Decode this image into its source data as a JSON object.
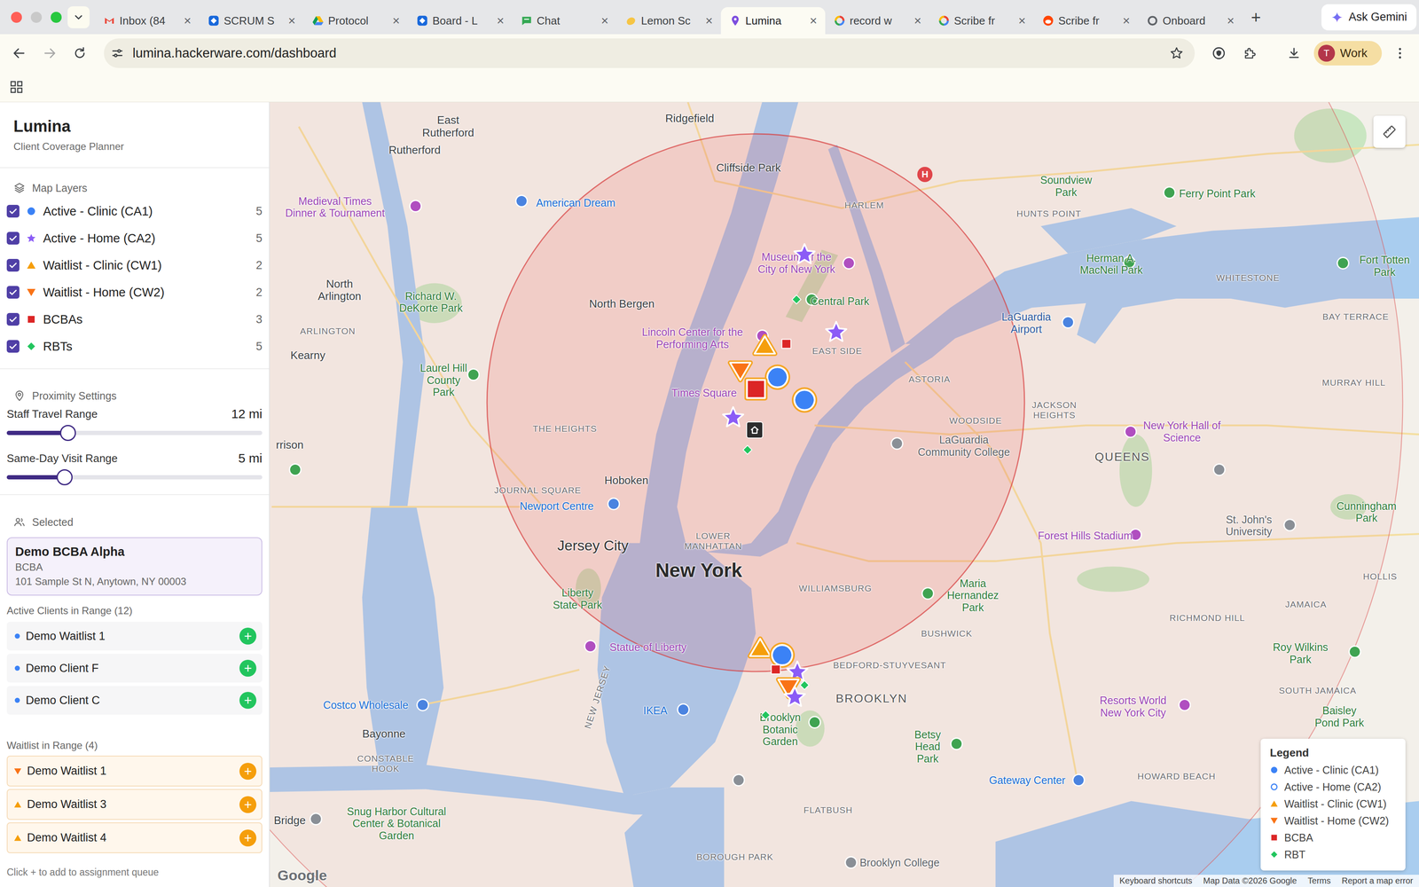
{
  "browser": {
    "tabs": [
      {
        "label": "Inbox (84",
        "kind": "gmail",
        "selected": false
      },
      {
        "label": "SCRUM S",
        "kind": "jira",
        "selected": false
      },
      {
        "label": "Protocol",
        "kind": "drive",
        "selected": false
      },
      {
        "label": "Board - L",
        "kind": "jira",
        "selected": false
      },
      {
        "label": "Chat",
        "kind": "chat",
        "selected": false
      },
      {
        "label": "Lemon Sc",
        "kind": "lemon",
        "selected": false
      },
      {
        "label": "Lumina",
        "kind": "pin",
        "selected": true
      },
      {
        "label": "record w",
        "kind": "google",
        "selected": false
      },
      {
        "label": "Scribe fr",
        "kind": "google",
        "selected": false
      },
      {
        "label": "Scribe fr",
        "kind": "reddit",
        "selected": false
      },
      {
        "label": "Onboard",
        "kind": "docs",
        "selected": false
      }
    ],
    "close": "×",
    "new_tab": "+",
    "gemini": "Ask Gemini",
    "url": "lumina.hackerware.com/dashboard",
    "profile": {
      "initial": "T",
      "label": "Work"
    }
  },
  "sidebar": {
    "title": "Lumina",
    "subtitle": "Client Coverage Planner",
    "layers_title": "Map Layers",
    "layers": [
      {
        "label": "Active - Clinic (CA1)",
        "count": "5",
        "checked": true,
        "kind": "circle",
        "color": "#3b82f6"
      },
      {
        "label": "Active - Home (CA2)",
        "count": "5",
        "checked": true,
        "kind": "star",
        "color": "#8b5cf6"
      },
      {
        "label": "Waitlist - Clinic (CW1)",
        "count": "2",
        "checked": true,
        "kind": "triangle",
        "color": "#f59e0b"
      },
      {
        "label": "Waitlist - Home (CW2)",
        "count": "2",
        "checked": true,
        "kind": "triangle-down",
        "color": "#f97316"
      },
      {
        "label": "BCBAs",
        "count": "3",
        "checked": true,
        "kind": "square",
        "color": "#dc2626"
      },
      {
        "label": "RBTs",
        "count": "5",
        "checked": true,
        "kind": "diamond",
        "color": "#22c55e"
      }
    ],
    "proximity_title": "Proximity Settings",
    "sliders": [
      {
        "label": "Staff Travel Range",
        "reading": "12 mi",
        "level": 0.24
      },
      {
        "label": "Same-Day Visit Range",
        "reading": "5 mi",
        "level": 0.227
      }
    ],
    "selected_title": "Selected",
    "selected": {
      "name": "Demo BCBA Alpha",
      "role": "BCBA",
      "address": "101 Sample St N, Anytown, NY 00003"
    },
    "add_label": "+",
    "active_title": "Active Clients in Range (12)",
    "active_clients": [
      {
        "name": "Demo Waitlist 1",
        "kind": "circle"
      },
      {
        "name": "Demo Client F",
        "kind": "circle"
      },
      {
        "name": "Demo Client C",
        "kind": "circle"
      }
    ],
    "waitlist_title": "Waitlist in Range (4)",
    "waitlist": [
      {
        "name": "Demo Waitlist 1",
        "kind": "triangle-down"
      },
      {
        "name": "Demo Waitlist 3",
        "kind": "triangle"
      },
      {
        "name": "Demo Waitlist 4",
        "kind": "triangle"
      }
    ],
    "hint": "Click + to add to assignment queue"
  },
  "map": {
    "labels": [
      {
        "text": "East Rutherford",
        "kind": "place",
        "color": "#3c4043"
      },
      {
        "text": "Ridgefield",
        "kind": "place",
        "color": "#3c4043"
      },
      {
        "text": "Rutherford",
        "kind": "place",
        "color": "#3c4043"
      },
      {
        "text": "Cliffside Park",
        "kind": "place",
        "color": "#3c4043"
      },
      {
        "text": "Medieval Times Dinner & Tournament",
        "kind": "poi",
        "color": "#9b45b5"
      },
      {
        "text": "American Dream",
        "kind": "poi",
        "color": "#1a6fd6"
      },
      {
        "text": "HARLEM",
        "kind": "district",
        "color": "#6f6f73"
      },
      {
        "text": "North Arlington",
        "kind": "place",
        "color": "#3c4043"
      },
      {
        "text": "North Bergen",
        "kind": "place",
        "color": "#3c4043"
      },
      {
        "text": "Richard W. DeKorte Park",
        "kind": "poi",
        "color": "#2f7d3b"
      },
      {
        "text": "ARLINGTON",
        "kind": "district",
        "color": "#6f6f73"
      },
      {
        "text": "Kearny",
        "kind": "place",
        "color": "#3c4043"
      },
      {
        "text": "Museum of the City of New York",
        "kind": "poi",
        "color": "#9b45b5"
      },
      {
        "text": "Central Park",
        "kind": "poi",
        "color": "#2f7d3b"
      },
      {
        "text": "Lincoln Center for the Performing Arts",
        "kind": "poi",
        "color": "#9b45b5"
      },
      {
        "text": "EAST SIDE",
        "kind": "district",
        "color": "#6f6f73"
      },
      {
        "text": "Times Square",
        "kind": "poi",
        "color": "#9b45b5"
      },
      {
        "text": "ASTORIA",
        "kind": "district",
        "color": "#6f6f73"
      },
      {
        "text": "Laurel Hill County Park",
        "kind": "poi",
        "color": "#2f7d3b"
      },
      {
        "text": "LaGuardia Airport",
        "kind": "poi",
        "color": "#2d5aa0"
      },
      {
        "text": "Soundview Park",
        "kind": "poi",
        "color": "#2f7d3b"
      },
      {
        "text": "HUNTS POINT",
        "kind": "district",
        "color": "#6f6f73"
      },
      {
        "text": "Herman A. MacNeil Park",
        "kind": "poi",
        "color": "#2f7d3b"
      },
      {
        "text": "WHITESTONE",
        "kind": "district",
        "color": "#6f6f73"
      },
      {
        "text": "Ferry Point Park",
        "kind": "poi",
        "color": "#2f7d3b"
      },
      {
        "text": "Fort Totten Park",
        "kind": "poi",
        "color": "#2f7d3b"
      },
      {
        "text": "BAY TERRACE",
        "kind": "district",
        "color": "#6f6f73"
      },
      {
        "text": "MURRAY HILL",
        "kind": "district",
        "color": "#6f6f73"
      },
      {
        "text": "JACKSON HEIGHTS",
        "kind": "district",
        "color": "#6f6f73"
      },
      {
        "text": "WOODSIDE",
        "kind": "district",
        "color": "#6f6f73"
      },
      {
        "text": "LaGuardia Community College",
        "kind": "poi",
        "color": "#5f6368"
      },
      {
        "text": "New York Hall of Science",
        "kind": "poi",
        "color": "#9b45b5"
      },
      {
        "text": "QUEENS",
        "kind": "borough",
        "color": "#555555"
      },
      {
        "text": "THE HEIGHTS",
        "kind": "district",
        "color": "#6f6f73"
      },
      {
        "text": "Hoboken",
        "kind": "place",
        "color": "#3c4043"
      },
      {
        "text": "JOURNAL SQUARE",
        "kind": "district",
        "color": "#6f6f73"
      },
      {
        "text": "Newport Centre",
        "kind": "poi",
        "color": "#1a6fd6"
      },
      {
        "text": "LOWER MANHATTAN",
        "kind": "district",
        "color": "#6f6f73"
      },
      {
        "text": "Jersey City",
        "kind": "town",
        "color": "#333333"
      },
      {
        "text": "New York",
        "kind": "city",
        "color": "#2b2b2b"
      },
      {
        "text": "WILLIAMSBURG",
        "kind": "district",
        "color": "#6f6f73"
      },
      {
        "text": "Forest Hills Stadium",
        "kind": "poi",
        "color": "#9b45b5"
      },
      {
        "text": "St. John's University",
        "kind": "poi",
        "color": "#5f6368"
      },
      {
        "text": "Cunningham Park",
        "kind": "poi",
        "color": "#2f7d3b"
      },
      {
        "text": "Liberty State Park",
        "kind": "poi",
        "color": "#2f7d3b"
      },
      {
        "text": "Maria Hernandez Park",
        "kind": "poi",
        "color": "#2f7d3b"
      },
      {
        "text": "BUSHWICK",
        "kind": "district",
        "color": "#6f6f73"
      },
      {
        "text": "Statue of Liberty",
        "kind": "poi",
        "color": "#9b45b5"
      },
      {
        "text": "BEDFORD-STUYVESANT",
        "kind": "district",
        "color": "#6f6f73"
      },
      {
        "text": "RICHMOND HILL",
        "kind": "district",
        "color": "#6f6f73"
      },
      {
        "text": "HOLLIS",
        "kind": "district",
        "color": "#6f6f73"
      },
      {
        "text": "JAMAICA",
        "kind": "district",
        "color": "#6f6f73"
      },
      {
        "text": "Roy Wilkins Park",
        "kind": "poi",
        "color": "#2f7d3b"
      },
      {
        "text": "SOUTH JAMAICA",
        "kind": "district",
        "color": "#6f6f73"
      },
      {
        "text": "BROOKLYN",
        "kind": "borough",
        "color": "#555555"
      },
      {
        "text": "Costco Wholesale",
        "kind": "poi",
        "color": "#1a6fd6"
      },
      {
        "text": "IKEA",
        "kind": "poi",
        "color": "#1a6fd6"
      },
      {
        "text": "Brooklyn Botanic Garden",
        "kind": "poi",
        "color": "#2f7d3b"
      },
      {
        "text": "Resorts World New York City",
        "kind": "poi",
        "color": "#9b45b5"
      },
      {
        "text": "Baisley Pond Park",
        "kind": "poi",
        "color": "#2f7d3b"
      },
      {
        "text": "Bayonne",
        "kind": "place",
        "color": "#3c4043"
      },
      {
        "text": "Betsy Head Park",
        "kind": "poi",
        "color": "#2f7d3b"
      },
      {
        "text": "CONSTABLE HOOK",
        "kind": "district",
        "color": "#6f6f73"
      },
      {
        "text": "Gateway Center",
        "kind": "poi",
        "color": "#1a6fd6"
      },
      {
        "text": "HOWARD BEACH",
        "kind": "district",
        "color": "#6f6f73"
      },
      {
        "text": "NEW JERSEY",
        "kind": "state",
        "color": "#6f6f73"
      },
      {
        "text": "Snug Harbor Cultural Center & Botanical Garden",
        "kind": "poi",
        "color": "#2f7d3b"
      },
      {
        "text": "Bridge",
        "kind": "place",
        "color": "#3c4043"
      },
      {
        "text": "FLATBUSH",
        "kind": "district",
        "color": "#6f6f73"
      },
      {
        "text": "BOROUGH PARK",
        "kind": "district",
        "color": "#6f6f73"
      },
      {
        "text": "Brooklyn College",
        "kind": "poi",
        "color": "#5f6368"
      },
      {
        "text": "rrison",
        "kind": "place",
        "color": "#3c4043"
      }
    ],
    "markers": [
      {
        "kind": "star",
        "highlighted": false,
        "selected": false
      },
      {
        "kind": "diamond",
        "highlighted": false,
        "selected": false
      },
      {
        "kind": "triangle",
        "highlighted": true,
        "selected": false
      },
      {
        "kind": "square",
        "highlighted": false,
        "selected": false
      },
      {
        "kind": "triangle-down",
        "highlighted": true,
        "selected": false
      },
      {
        "kind": "circle",
        "highlighted": true,
        "selected": false
      },
      {
        "kind": "star",
        "highlighted": false,
        "selected": false
      },
      {
        "kind": "star",
        "highlighted": false,
        "selected": false
      },
      {
        "kind": "home",
        "highlighted": false,
        "selected": false
      },
      {
        "kind": "diamond",
        "highlighted": false,
        "selected": false
      },
      {
        "kind": "circle",
        "highlighted": true,
        "selected": false
      },
      {
        "kind": "square",
        "highlighted": true,
        "selected": true
      },
      {
        "kind": "triangle",
        "highlighted": true,
        "selected": false
      },
      {
        "kind": "circle",
        "highlighted": true,
        "selected": false
      },
      {
        "kind": "star",
        "highlighted": false,
        "selected": false
      },
      {
        "kind": "square",
        "highlighted": false,
        "selected": false
      },
      {
        "kind": "triangle-down",
        "highlighted": true,
        "selected": false
      },
      {
        "kind": "diamond",
        "highlighted": false,
        "selected": false
      },
      {
        "kind": "star",
        "highlighted": false,
        "selected": false
      },
      {
        "kind": "diamond",
        "highlighted": false,
        "selected": false
      }
    ],
    "hospital": "H",
    "legend": {
      "title": "Legend",
      "items": [
        {
          "label": "Active - Clinic (CA1)",
          "kind": "circle",
          "color": "#3b82f6"
        },
        {
          "label": "Active - Home (CA2)",
          "kind": "ring",
          "color": "#3b82f6"
        },
        {
          "label": "Waitlist - Clinic (CW1)",
          "kind": "triangle",
          "color": "#f59e0b"
        },
        {
          "label": "Waitlist - Home (CW2)",
          "kind": "triangle-down",
          "color": "#f97316"
        },
        {
          "label": "BCBA",
          "kind": "square",
          "color": "#dc2626"
        },
        {
          "label": "RBT",
          "kind": "diamond",
          "color": "#22c55e"
        }
      ]
    },
    "logo": "Google",
    "attribution": [
      "Keyboard shortcuts",
      "Map Data ©2026 Google",
      "Terms",
      "Report a map error"
    ]
  }
}
